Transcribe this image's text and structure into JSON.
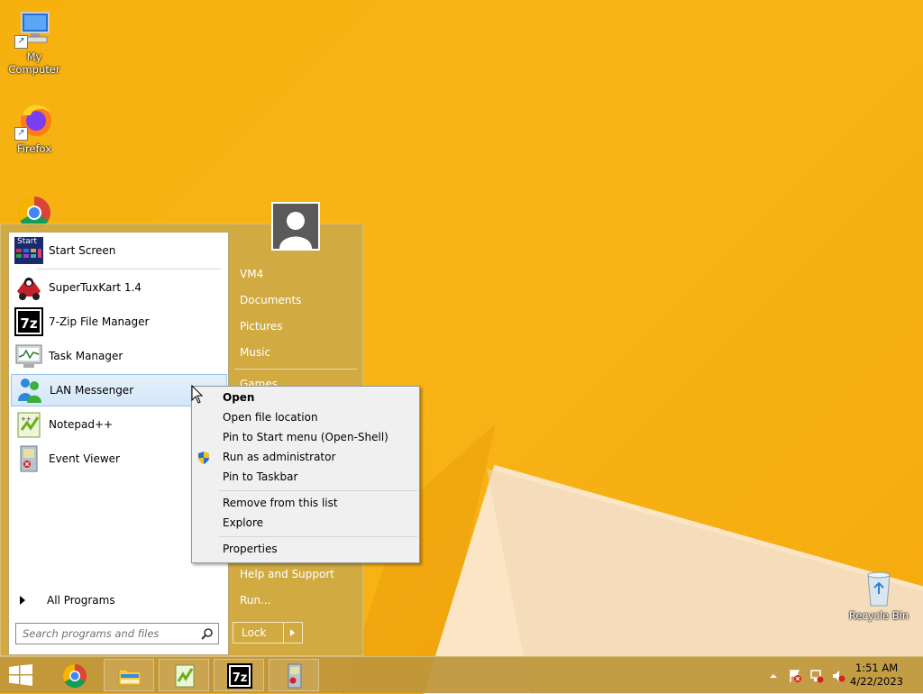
{
  "desktop": {
    "icons": [
      {
        "label": "My Computer",
        "icon": "computer-icon"
      },
      {
        "label": "Firefox",
        "icon": "firefox-icon"
      },
      {
        "label": "",
        "icon": "chrome-icon"
      },
      {
        "label": "Recycle Bin",
        "icon": "recycle-bin-icon"
      }
    ]
  },
  "start_menu": {
    "programs": [
      {
        "label": "Start Screen",
        "icon": "start-screen-icon"
      },
      {
        "label": "SuperTuxKart 1.4",
        "icon": "supertuxkart-icon"
      },
      {
        "label": "7-Zip File Manager",
        "icon": "7zip-icon"
      },
      {
        "label": "Task Manager",
        "icon": "task-manager-icon"
      },
      {
        "label": "LAN Messenger",
        "icon": "lan-messenger-icon"
      },
      {
        "label": "Notepad++",
        "icon": "notepadpp-icon"
      },
      {
        "label": "Event Viewer",
        "icon": "event-viewer-icon"
      }
    ],
    "start_screen_badge": "Start",
    "all_programs": "All Programs",
    "search_placeholder": "Search programs and files",
    "right_items": [
      "VM4",
      "Documents",
      "Pictures",
      "Music",
      "Games",
      "Help and Support",
      "Run..."
    ],
    "lock_label": "Lock"
  },
  "context_menu": {
    "items": [
      "Open",
      "Open file location",
      "Pin to Start menu (Open-Shell)",
      "Run as administrator",
      "Pin to Taskbar",
      "Remove from this list",
      "Explore",
      "Properties"
    ]
  },
  "taskbar": {
    "pinned": [
      "start-icon",
      "chrome-icon",
      "file-explorer-icon",
      "notepadpp-icon",
      "7zip-icon",
      "event-viewer-icon"
    ],
    "seven_zip_text": "7z",
    "clock_time": "1:51 AM",
    "clock_date": "4/22/2023"
  },
  "colors": {
    "wallpaper": "#f6b10e",
    "start_menu_bg": "#cdaa46",
    "highlight": "#d4e7f9"
  }
}
